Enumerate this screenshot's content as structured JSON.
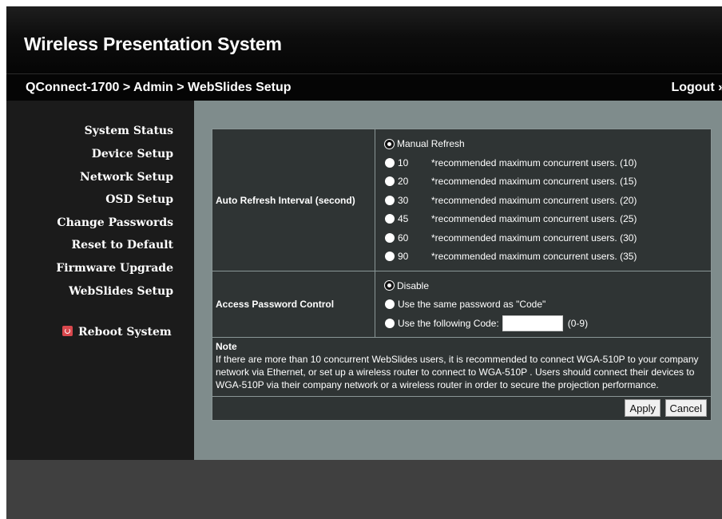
{
  "header": {
    "app_title": "Wireless Presentation System",
    "breadcrumb": "QConnect-1700 > Admin > WebSlides Setup",
    "logout_label": "Logout »"
  },
  "sidebar": {
    "items": [
      {
        "label": "System Status"
      },
      {
        "label": "Device Setup"
      },
      {
        "label": "Network Setup"
      },
      {
        "label": "OSD Setup"
      },
      {
        "label": "Change Passwords"
      },
      {
        "label": "Reset to Default"
      },
      {
        "label": "Firmware Upgrade"
      },
      {
        "label": "WebSlides Setup"
      }
    ],
    "reboot_label": "Reboot System",
    "reboot_icon": "power-icon"
  },
  "form": {
    "refresh": {
      "label": "Auto Refresh Interval (second)",
      "options": [
        {
          "value": "Manual Refresh",
          "note": "",
          "checked": true
        },
        {
          "value": "10",
          "note": "*recommended maximum concurrent users. (10)",
          "checked": false
        },
        {
          "value": "20",
          "note": "*recommended maximum concurrent users. (15)",
          "checked": false
        },
        {
          "value": "30",
          "note": "*recommended maximum concurrent users. (20)",
          "checked": false
        },
        {
          "value": "45",
          "note": "*recommended maximum concurrent users. (25)",
          "checked": false
        },
        {
          "value": "60",
          "note": "*recommended maximum concurrent users. (30)",
          "checked": false
        },
        {
          "value": "90",
          "note": "*recommended maximum concurrent users. (35)",
          "checked": false
        }
      ]
    },
    "password": {
      "label": "Access Password Control",
      "options": [
        {
          "value": "Disable",
          "checked": true
        },
        {
          "value": "Use the same password as \"Code\"",
          "checked": false
        },
        {
          "value": "Use the following Code:",
          "checked": false
        }
      ],
      "code_value": "",
      "code_range": "(0-9)"
    },
    "note": {
      "title": "Note",
      "text": "If there are more than 10 concurrent WebSlides users, it is recommended to connect WGA-510P to your company network via Ethernet, or set up a wireless router to connect to WGA-510P . Users should connect their devices to WGA-510P via their company network or a wireless router in order to secure the projection performance."
    },
    "apply_label": "Apply",
    "cancel_label": "Cancel"
  }
}
